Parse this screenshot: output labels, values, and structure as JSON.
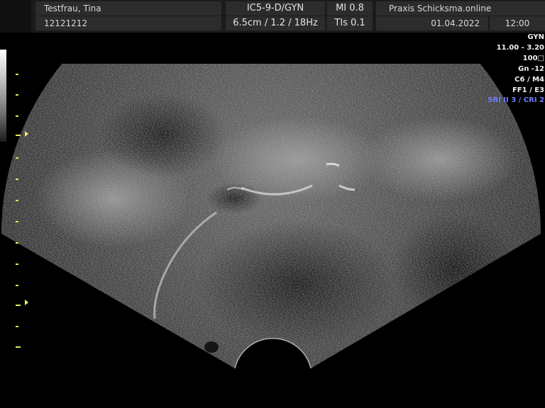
{
  "header": {
    "patient_name": "Testfrau, Tina",
    "patient_id": "12121212",
    "probe_preset": "IC5-9-D/GYN",
    "depth_info": "6.5cm / 1.2 / 18Hz",
    "mi": "MI 0.8",
    "tis": "TIs 0.1",
    "institution": "Praxis Schicksma.online",
    "date": "01.04.2022",
    "time": "12:00"
  },
  "params": {
    "mode": "GYN",
    "frequency": "11.00 - 3.20",
    "power": "100",
    "gain": "Gn -12",
    "map": "C6 / M4",
    "filter": "FF1 / E3",
    "sri_cri": "SRI II 3 / CRI 2"
  },
  "image": {
    "type": "transvaginal-ultrasound-sector",
    "background_color": "#000000",
    "text_color": "#e0e0e0",
    "accent_blue": "#6d7cff",
    "marker_color": "#f2ee7a"
  }
}
